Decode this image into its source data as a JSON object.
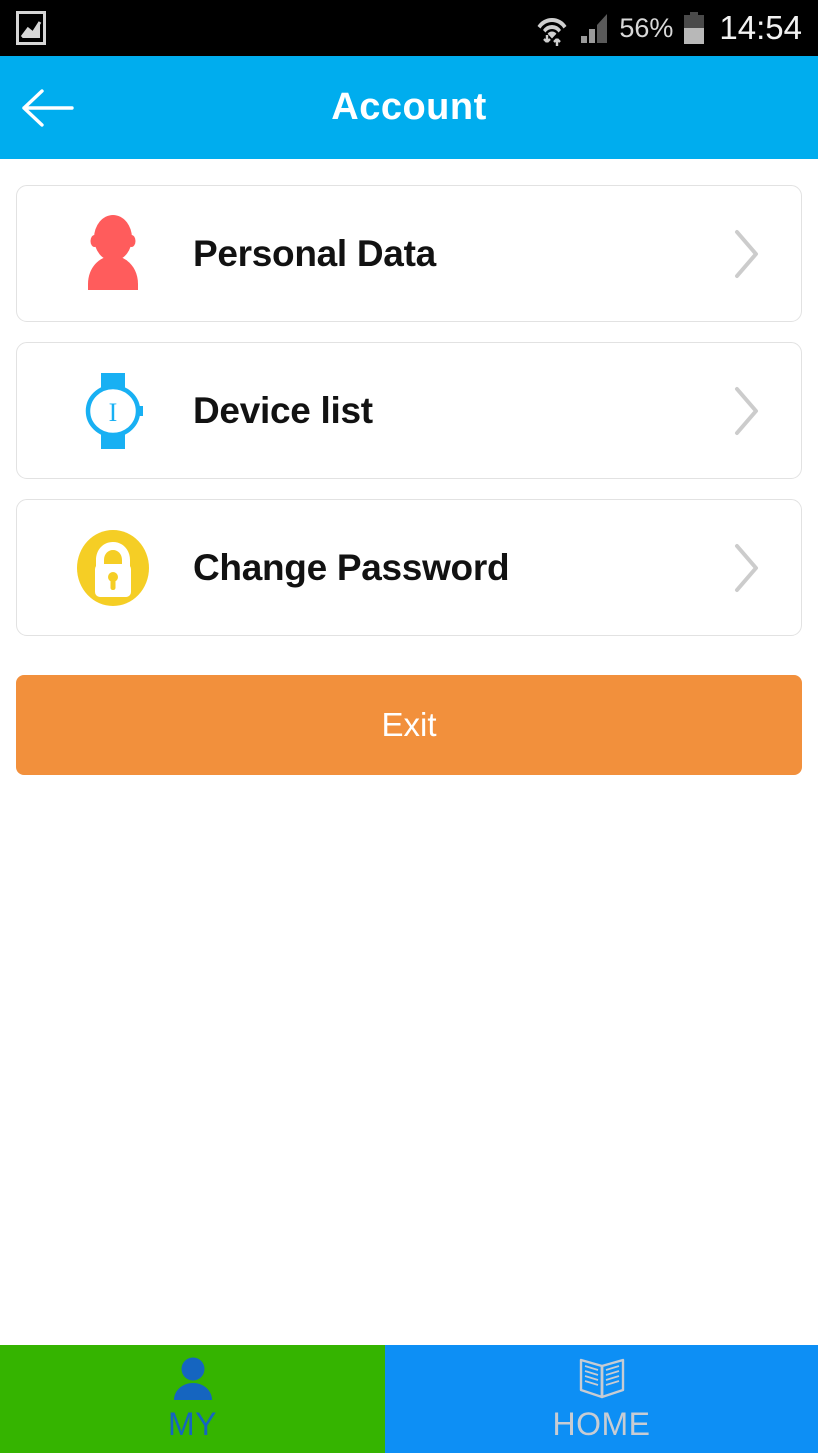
{
  "status_bar": {
    "gallery_icon": "gallery-icon",
    "wifi_icon": "wifi-icon",
    "signal_icon": "signal-bars-icon",
    "battery_percent": "56%",
    "battery_icon": "battery-icon",
    "time": "14:54",
    "background": "#000000"
  },
  "header": {
    "title": "Account",
    "back_icon": "back-arrow-icon",
    "background": "#00ADEE",
    "text_color": "#FFFFFF"
  },
  "menu": {
    "items": [
      {
        "label": "Personal Data",
        "icon": "person-icon",
        "icon_color": "#FF5C5C",
        "chevron": "chevron-right-icon"
      },
      {
        "label": "Device list",
        "icon": "watch-icon",
        "icon_color": "#18B0F3",
        "chevron": "chevron-right-icon"
      },
      {
        "label": "Change Password",
        "icon": "lock-icon",
        "icon_color": "#F5CE25",
        "chevron": "chevron-right-icon"
      }
    ]
  },
  "exit": {
    "label": "Exit",
    "background": "#F2903C",
    "text_color": "#FFFFFF"
  },
  "bottom_nav": {
    "tabs": [
      {
        "label": "MY",
        "icon": "person-filled-icon",
        "background": "#35B400",
        "text_color": "#1565C0",
        "active": "true"
      },
      {
        "label": "HOME",
        "icon": "open-book-icon",
        "background": "#0D8FF5",
        "text_color": "#C7CCD3",
        "active": "false"
      }
    ]
  }
}
